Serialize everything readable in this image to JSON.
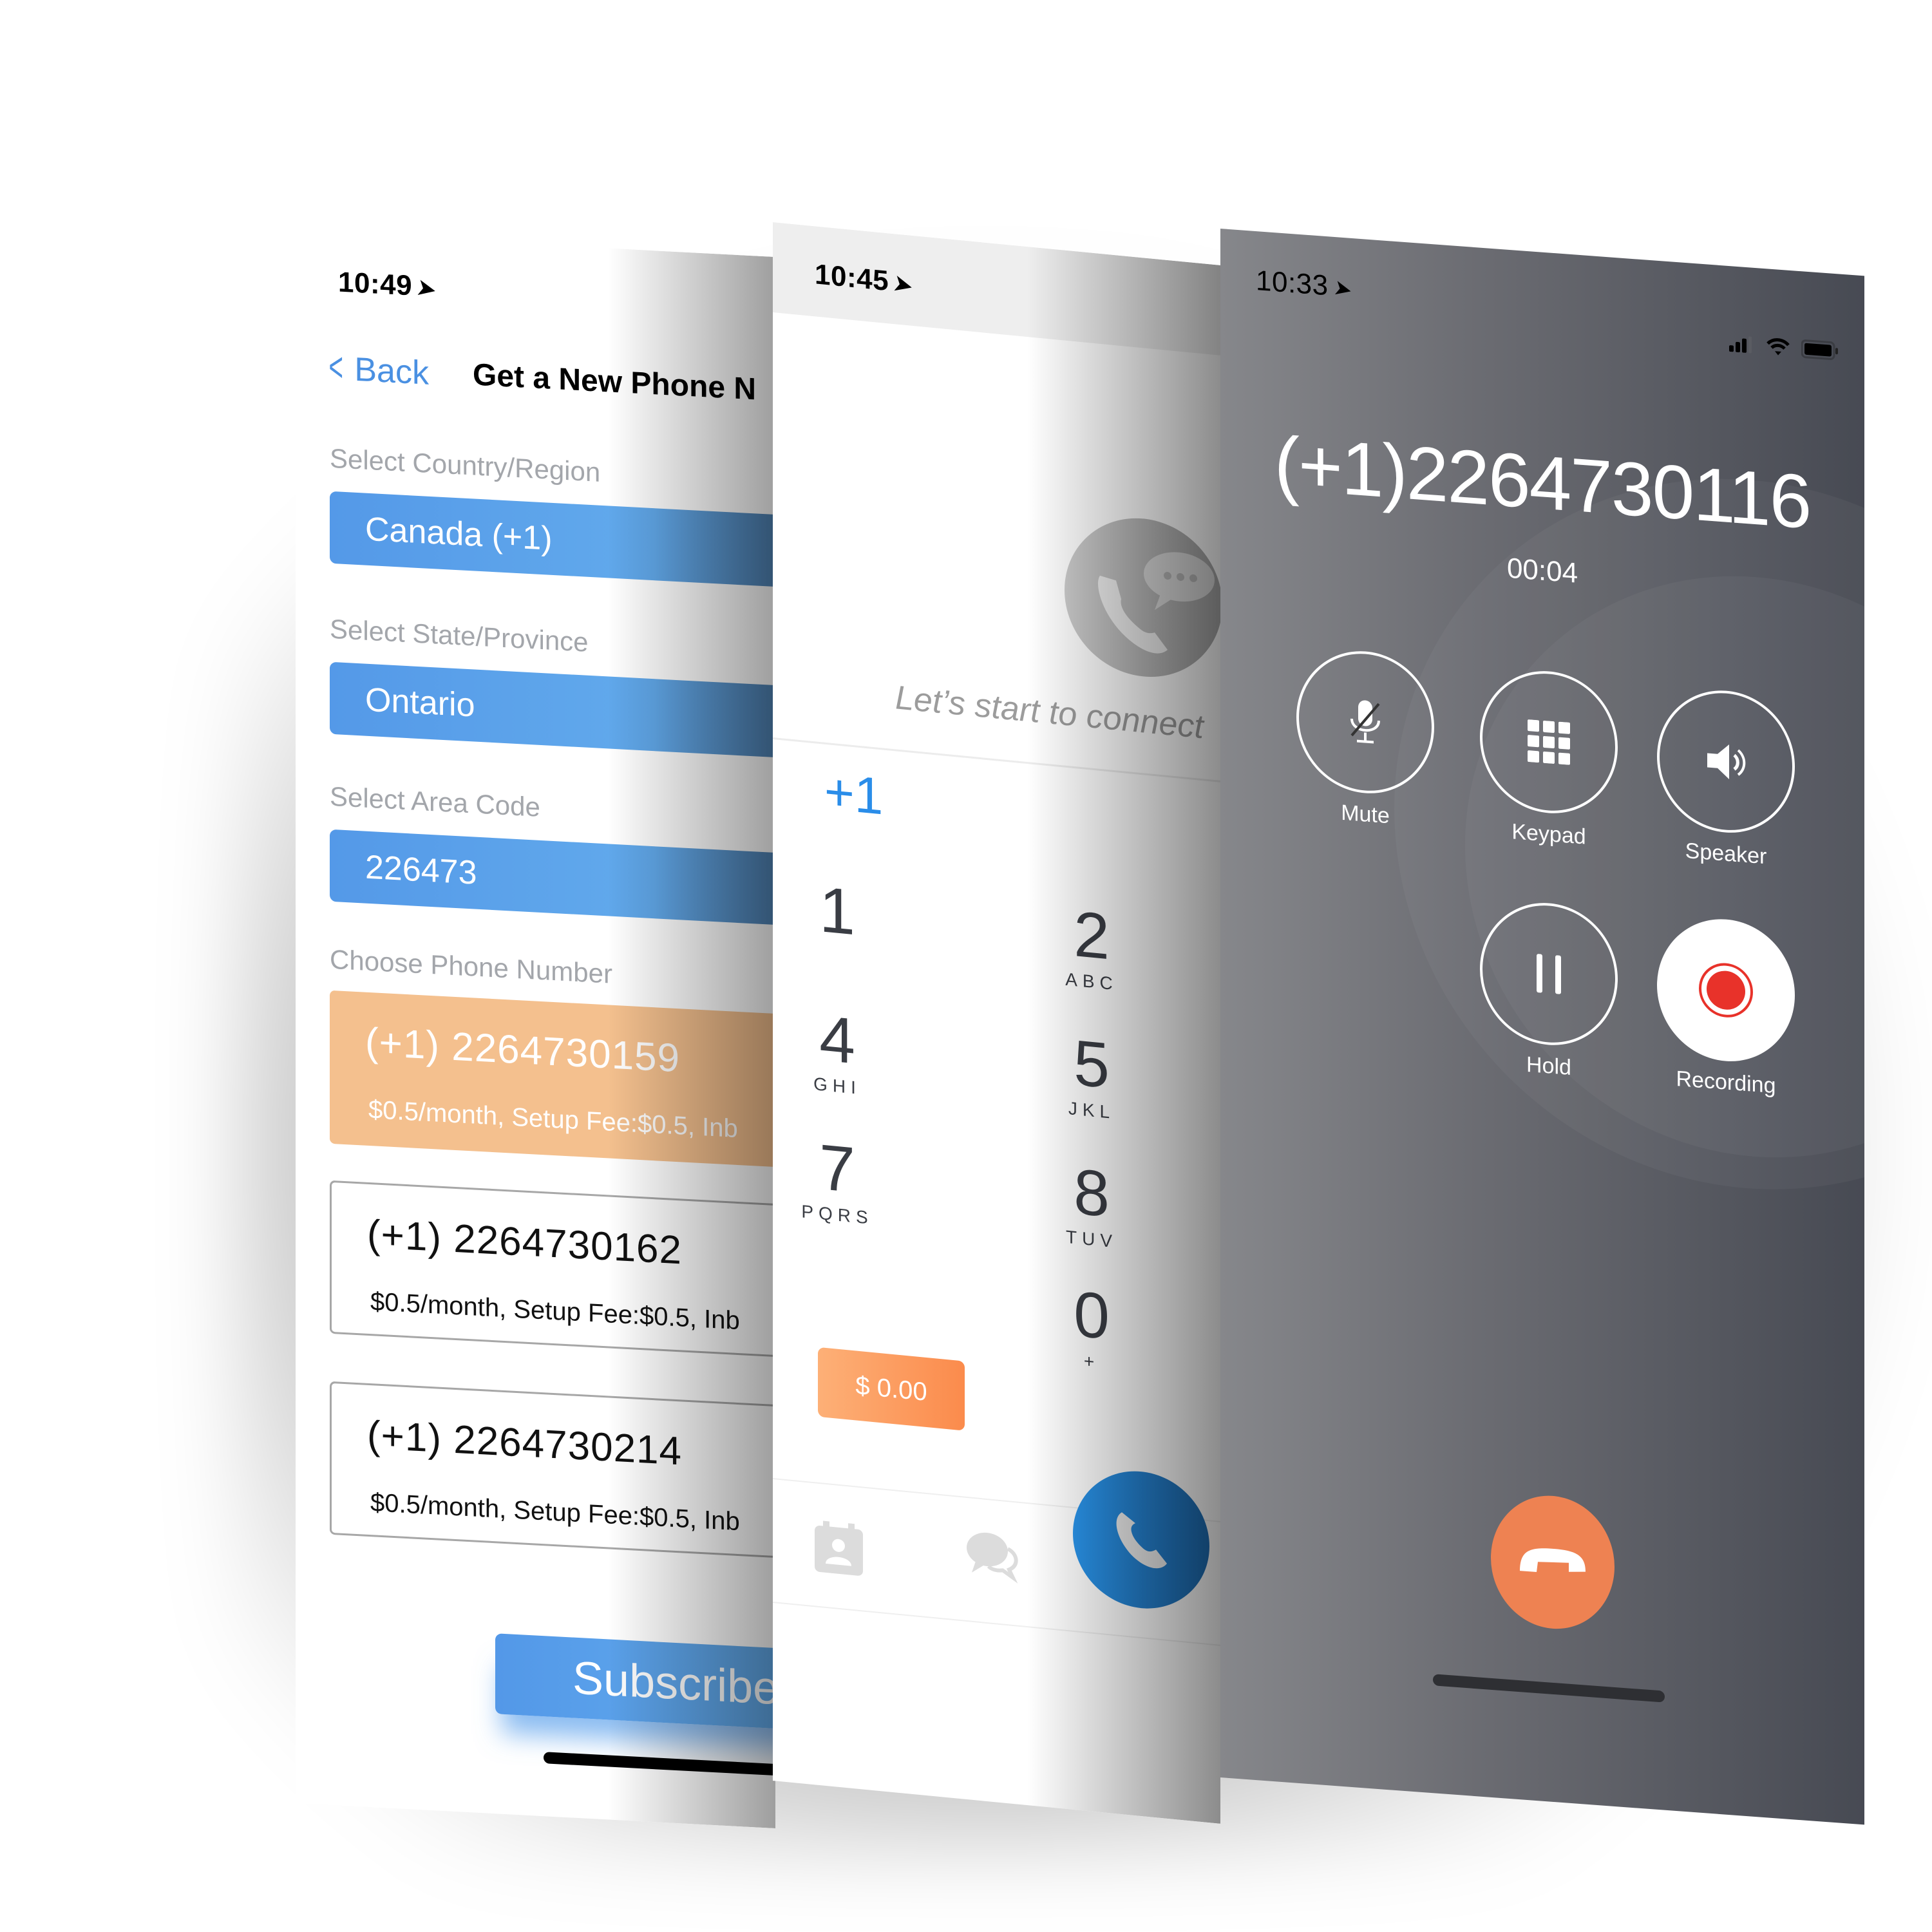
{
  "colors": {
    "accent_blue": "#4a90e2",
    "select_blue": "#5ba3ea",
    "selected_orange": "#f4c08e",
    "balance_orange": "#fc9a5c",
    "call_blue": "#2a8de9",
    "hangup_orange": "#ee8252",
    "record_red": "#e8322a",
    "call_bg_dark": "#474a53"
  },
  "left_screen": {
    "status_time": "10:49",
    "back_label": "Back",
    "title": "Get a New Phone N",
    "country": {
      "label": "Select Country/Region",
      "value": "Canada (+1)"
    },
    "state": {
      "label": "Select State/Province",
      "value": "Ontario"
    },
    "area_code": {
      "label": "Select Area Code",
      "value": "226473"
    },
    "choose_label": "Choose Phone Number",
    "numbers": [
      {
        "number": "(+1) 2264730159",
        "price": "$0.5/month, Setup Fee:$0.5, Inb",
        "selected": true
      },
      {
        "number": "(+1) 2264730162",
        "price": "$0.5/month, Setup Fee:$0.5, Inb",
        "selected": false
      },
      {
        "number": "(+1) 2264730214",
        "price": "$0.5/month, Setup Fee:$0.5, Inb",
        "selected": false
      }
    ],
    "subscribe_label": "Subscribe"
  },
  "middle_screen": {
    "status_time": "10:45",
    "empty_message": "Let’s start to connect",
    "country_code": "+1",
    "keys": [
      {
        "digit": "1",
        "letters": ""
      },
      {
        "digit": "2",
        "letters": "ABC"
      },
      {
        "digit": "4",
        "letters": "GHI"
      },
      {
        "digit": "5",
        "letters": "JKL"
      },
      {
        "digit": "7",
        "letters": "PQRS"
      },
      {
        "digit": "8",
        "letters": "TUV"
      },
      {
        "digit": "0",
        "letters": "+"
      }
    ],
    "balance": "$ 0.00",
    "tabs": [
      "contacts-icon",
      "messages-icon",
      "call-icon"
    ]
  },
  "right_screen": {
    "status_time": "10:33",
    "status_icons": [
      "signal-icon",
      "wifi-icon",
      "battery-icon"
    ],
    "caller_number": "(+1)2264730116",
    "call_duration": "00:04",
    "controls": [
      {
        "label": "Mute",
        "icon": "mic-off-icon"
      },
      {
        "label": "Keypad",
        "icon": "keypad-icon"
      },
      {
        "label": "Speaker",
        "icon": "speaker-icon"
      },
      {
        "label": "Hold",
        "icon": "pause-icon"
      },
      {
        "label": "Recording",
        "icon": "record-icon",
        "active": true
      }
    ]
  }
}
